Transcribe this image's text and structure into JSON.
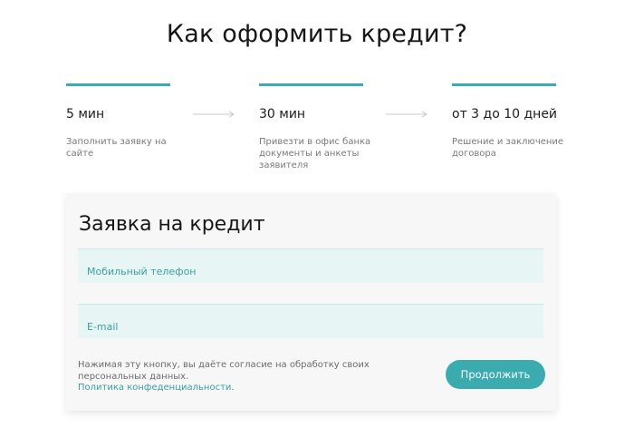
{
  "page": {
    "title": "Как оформить кредит?"
  },
  "steps": [
    {
      "time": "5 мин",
      "description": "Заполнить заявку на сайте"
    },
    {
      "time": "30 мин",
      "description": "Привезти в офис банка документы и анкеты заявителя"
    },
    {
      "time": "от 3 до 10 дней",
      "description": "Решение и заключение договора"
    }
  ],
  "form": {
    "title": "Заявка на кредит",
    "phone_label": "Мобильный телефон",
    "email_label": "E-mail",
    "consent_text": "Нажимая эту кнопку, вы даёте согласие на обработку своих персональных данных.",
    "privacy_link": "Политика конфеденциальности",
    "privacy_suffix": ".",
    "submit_label": "Продолжить"
  },
  "colors": {
    "accent": "#3aacaf",
    "field_bg": "#e7f6f5",
    "card_bg": "#f7f7f7",
    "arrow": "#c8c8c8"
  },
  "icons": {
    "step_separator": "arrow-right-icon"
  }
}
